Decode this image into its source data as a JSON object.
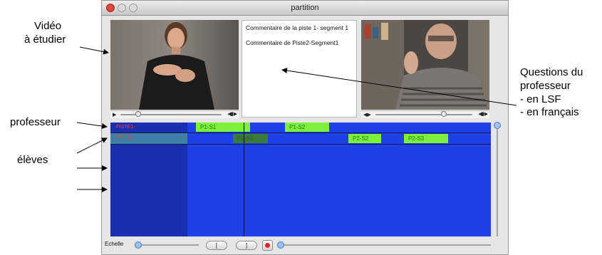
{
  "window": {
    "title": "partition"
  },
  "annotations": {
    "video_line1": "Vidéo",
    "video_line2": "à étudier",
    "questions_line1": "Questions du",
    "questions_line2": "professeur",
    "questions_line3": "- en LSF",
    "questions_line4": "- en français",
    "professeur": "professeur",
    "eleves": "élèves"
  },
  "comments": [
    "Commentaire de la piste 1- segment 1",
    "Commentaire de Piste2-Segment1"
  ],
  "timeline": {
    "tracks": [
      {
        "label": "PISTE1",
        "segments": [
          "P1-S1",
          "P1-S2"
        ]
      },
      {
        "label": "PISTE2",
        "segments": [
          "P2-S1",
          "P2-S2",
          "P2-S3"
        ]
      }
    ]
  },
  "bottom_bar": {
    "echelle_label": "Echelle",
    "in_button": "[",
    "out_button": "]"
  },
  "colors": {
    "timeline_bg": "#1f3fe8",
    "segment": "#7ef03a",
    "record": "#e0261c"
  }
}
